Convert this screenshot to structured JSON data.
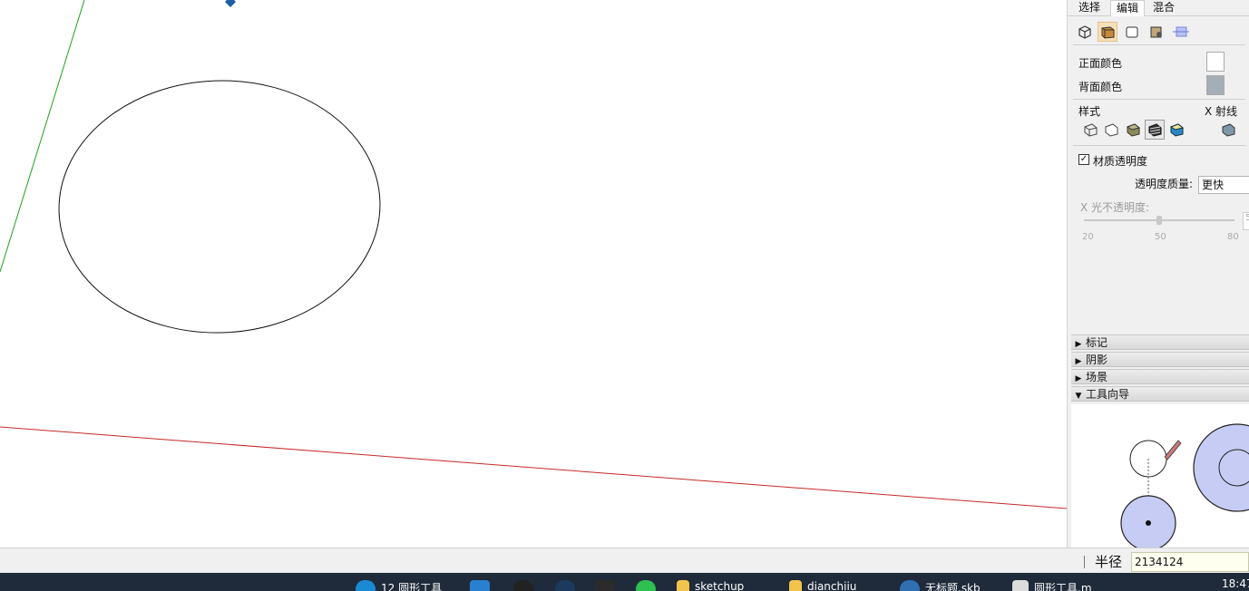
{
  "tray": {
    "tabs": [
      "选择",
      "编辑",
      "混合"
    ],
    "active_tab": "编辑",
    "face_front_label": "正面颜色",
    "face_back_label": "背面颜色",
    "front_color": "#ffffff",
    "back_color": "#a4aeb6",
    "style_label": "样式",
    "xray_label": "X 射线",
    "transparency_checkbox_label": "材质透明度",
    "transparency_checkbox_checked": true,
    "transparency_quality_label": "透明度质量:",
    "transparency_quality_value": "更快",
    "xray_opacity_label": "X 光不透明度:",
    "slider_ticks": [
      "20",
      "50",
      "80"
    ],
    "sections": [
      {
        "label": "标记",
        "expanded": false
      },
      {
        "label": "阴影",
        "expanded": false
      },
      {
        "label": "场景",
        "expanded": false
      },
      {
        "label": "工具向导",
        "expanded": true
      }
    ]
  },
  "statusbar": {
    "measurement_label": "半径",
    "measurement_value": "2134124"
  },
  "taskbar": {
    "items": [
      {
        "label": "12 圆形工具",
        "icon": "edge-icon"
      },
      {
        "label": "",
        "icon": "vscode-icon"
      },
      {
        "label": "",
        "icon": "qq-icon"
      },
      {
        "label": "",
        "icon": "steam-icon"
      },
      {
        "label": "",
        "icon": "epic-icon"
      },
      {
        "label": "",
        "icon": "wechat-icon"
      },
      {
        "label": "sketchup",
        "icon": "folder-icon"
      },
      {
        "label": "dianchiiu",
        "icon": "folder-icon"
      },
      {
        "label": "无标题.skb",
        "icon": "sketchup-icon"
      },
      {
        "label": "圆形工具.m",
        "icon": "document-icon"
      }
    ],
    "time": "18:47"
  },
  "colors": {
    "green_axis": "#1ea11e",
    "red_axis": "#c82828",
    "guide_blue": "#c6ccf4"
  }
}
